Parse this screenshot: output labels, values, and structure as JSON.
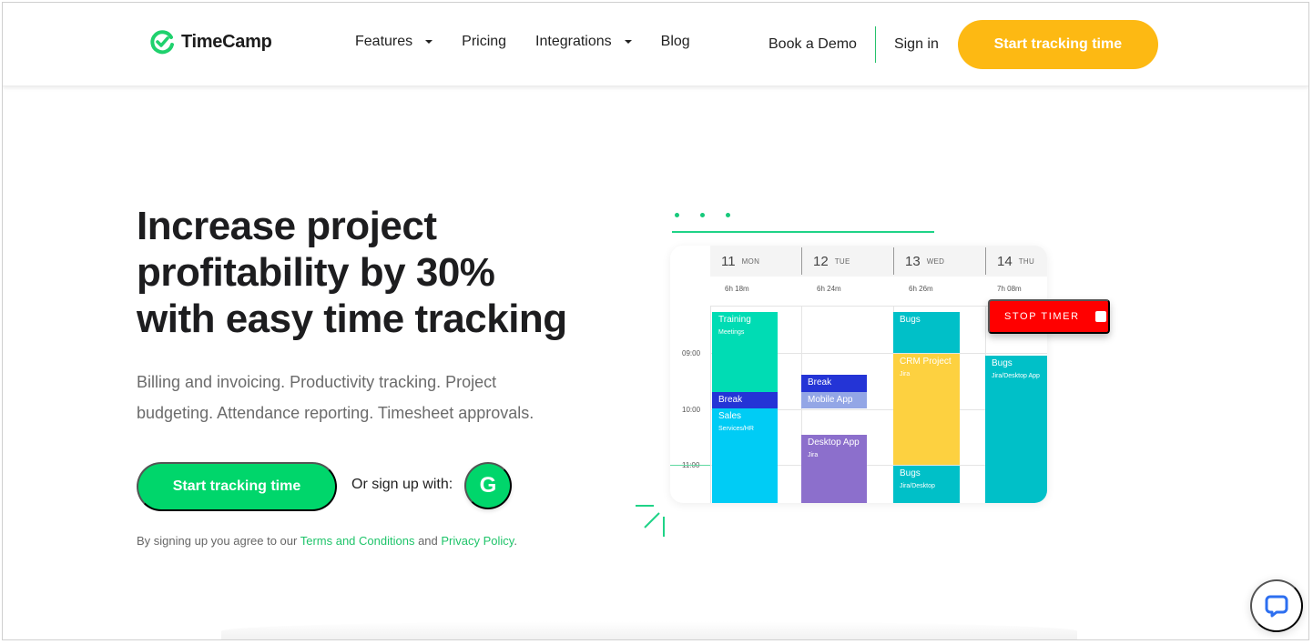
{
  "brand": {
    "name": "TimeCamp",
    "primary_color": "#00d66b",
    "accent_color": "#fdb913"
  },
  "nav": {
    "items": [
      {
        "label": "Features",
        "has_dropdown": true
      },
      {
        "label": "Pricing",
        "has_dropdown": false
      },
      {
        "label": "Integrations",
        "has_dropdown": true
      },
      {
        "label": "Blog",
        "has_dropdown": false
      }
    ],
    "book_demo": "Book a Demo",
    "sign_in": "Sign in",
    "cta": "Start tracking time"
  },
  "hero": {
    "title_lines": [
      "Increase project",
      "profitability by 30%",
      "with easy time tracking"
    ],
    "subtitle_lines": [
      "Billing and invoicing. Productivity tracking. Project",
      "budgeting. Attendance reporting. Timesheet approvals."
    ],
    "cta": "Start tracking time",
    "or_sign_up": "Or sign up with:",
    "google_letter": "G",
    "legal": {
      "prefix": "By signing up you agree to our ",
      "terms": "Terms and Conditions",
      "middle": " and ",
      "privacy": "Privacy Policy",
      "suffix": "."
    }
  },
  "calendar": {
    "days": [
      {
        "num": "11",
        "name": "MON",
        "total": "6h 18m"
      },
      {
        "num": "12",
        "name": "TUE",
        "total": "6h 24m"
      },
      {
        "num": "13",
        "name": "WED",
        "total": "6h 26m"
      },
      {
        "num": "14",
        "name": "THU",
        "total": "7h 08m"
      }
    ],
    "times": [
      "09:00",
      "10:00",
      "11:00"
    ],
    "events": [
      {
        "title": "Training",
        "sub": "Meetings",
        "color": "#00dcb4"
      },
      {
        "title": "Break",
        "sub": "",
        "color": "#2434d6"
      },
      {
        "title": "Sales",
        "sub": "Services/HR",
        "color": "#00ccf5"
      },
      {
        "title": "Break",
        "sub": "",
        "color": "#2434d6"
      },
      {
        "title": "Mobile App",
        "sub": "",
        "color": "#93a6e6"
      },
      {
        "title": "Desktop App",
        "sub": "Jira",
        "color": "#8c6fcc"
      },
      {
        "title": "Bugs",
        "sub": "",
        "color": "#00c0c8"
      },
      {
        "title": "CRM Project",
        "sub": "Jira",
        "color": "#fdd140"
      },
      {
        "title": "Bugs",
        "sub": "Jira/Desktop",
        "color": "#00c0c8"
      },
      {
        "title": "Bugs",
        "sub": "Jira/Desktop App",
        "color": "#00c0c8"
      }
    ],
    "stop_timer": "STOP TIMER"
  },
  "chat": {
    "icon": "chat-bubble-icon"
  }
}
